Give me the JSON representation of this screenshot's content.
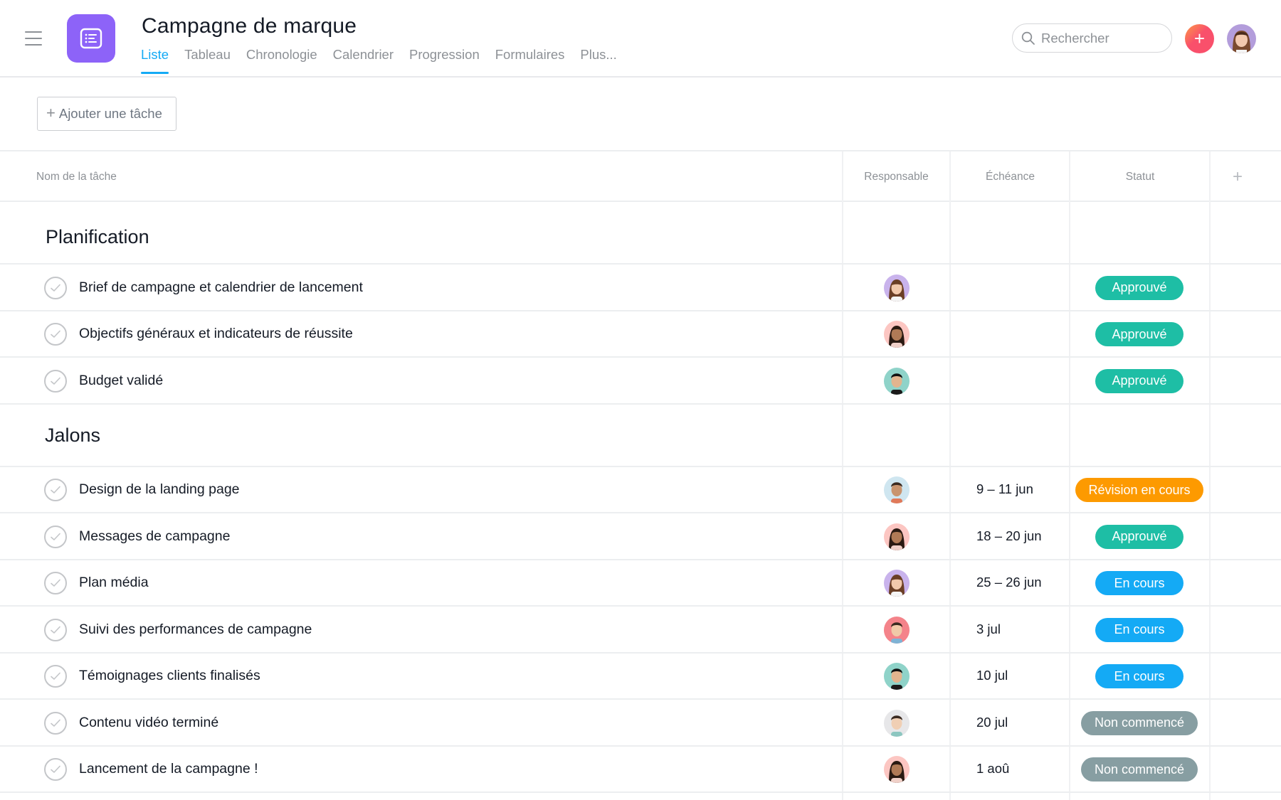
{
  "header": {
    "menu_icon": "hamburger-icon",
    "app_icon": "list-icon",
    "title": "Campagne de marque",
    "tabs": [
      {
        "label": "Liste",
        "active": true
      },
      {
        "label": "Tableau",
        "active": false
      },
      {
        "label": "Chronologie",
        "active": false
      },
      {
        "label": "Calendrier",
        "active": false
      },
      {
        "label": "Progression",
        "active": false
      },
      {
        "label": "Formulaires",
        "active": false
      },
      {
        "label": "Plus...",
        "active": false
      }
    ],
    "search": {
      "placeholder": "Rechercher",
      "value": ""
    },
    "add_button_label": "+",
    "accent_color": "#14aaf5",
    "app_icon_color": "#8d63f8"
  },
  "toolbar": {
    "add_task_label": "Ajouter une tâche",
    "add_task_icon": "+"
  },
  "table": {
    "columns": {
      "name": "Nom de la tâche",
      "assignee": "Responsable",
      "due": "Échéance",
      "status": "Statut",
      "add_column": "+"
    },
    "sections": [
      {
        "title": "Planification",
        "tasks": [
          {
            "name": "Brief de campagne et calendrier de lancement",
            "assignee": "avatar-woman-bangs",
            "due": "",
            "status": "Approuvé"
          },
          {
            "name": "Objectifs généraux et indicateurs de réussite",
            "assignee": "avatar-woman-longhair",
            "due": "",
            "status": "Approuvé"
          },
          {
            "name": "Budget validé",
            "assignee": "avatar-man-teal",
            "due": "",
            "status": "Approuvé"
          }
        ]
      },
      {
        "title": "Jalons",
        "tasks": [
          {
            "name": "Design de la landing page",
            "assignee": "avatar-man-glasses",
            "due": "9 – 11 jun",
            "status": "Révision en cours"
          },
          {
            "name": "Messages de campagne",
            "assignee": "avatar-woman-longhair",
            "due": "18 – 20 jun",
            "status": "Approuvé"
          },
          {
            "name": "Plan média",
            "assignee": "avatar-woman-bangs",
            "due": "25 – 26 jun",
            "status": "En cours"
          },
          {
            "name": "Suivi des performances de campagne",
            "assignee": "avatar-man-red",
            "due": "3 jul",
            "status": "En cours"
          },
          {
            "name": "Témoignages clients finalisés",
            "assignee": "avatar-man-teal",
            "due": "10 jul",
            "status": "En cours"
          },
          {
            "name": "Contenu vidéo terminé",
            "assignee": "avatar-woman-gray",
            "due": "20 jul",
            "status": "Non commencé"
          },
          {
            "name": "Lancement de la campagne !",
            "assignee": "avatar-woman-longhair",
            "due": "1 aoû",
            "status": "Non commencé"
          }
        ]
      }
    ]
  },
  "status_colors": {
    "Approuvé": "#1ebea5",
    "Révision en cours": "#fd9a00",
    "En cours": "#14aaf5",
    "Non commencé": "#879ea2"
  }
}
